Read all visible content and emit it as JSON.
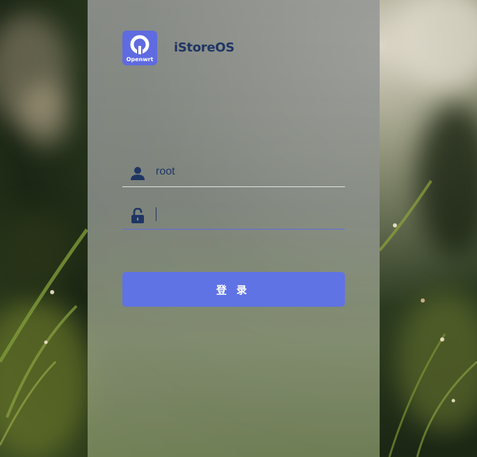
{
  "brand": {
    "logo_caption": "Openwrt",
    "title": "iStoreOS"
  },
  "form": {
    "username": {
      "value": "root",
      "icon": "user-icon"
    },
    "password": {
      "value": "",
      "icon": "unlock-icon"
    },
    "submit_label": "登录"
  },
  "colors": {
    "accent": "#5f73e4",
    "text": "#1f3563"
  }
}
